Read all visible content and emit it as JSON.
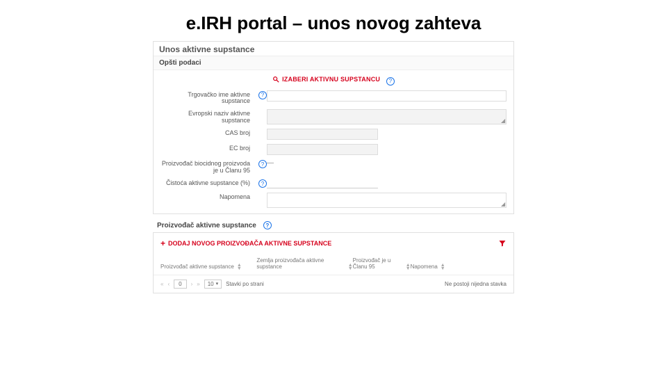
{
  "title": "e.IRH portal – unos novog zahteva",
  "panel1": {
    "title": "Unos aktivne supstance",
    "section": "Opšti podaci",
    "select_btn": "IZABERI AKTIVNU SUPSTANCU",
    "labels": {
      "trgovacko": "Trgovačko ime aktivne supstance",
      "evropski": "Evropski naziv aktivne supstance",
      "cas": "CAS broj",
      "ec": "EC broj",
      "clan95": "Proizvođač biocidnog proizvoda je u Članu 95",
      "cistoca": "Čistoća aktivne supstance (%)",
      "napomena": "Napomena"
    }
  },
  "panel2": {
    "section": "Proizvođač aktivne supstance",
    "add_btn": "DODAJ NOVOG PROIZVOĐAČA AKTIVNE SUPSTANCE",
    "columns": {
      "c1": "Proizvođač aktivne supstance",
      "c2": "Zemlja proizvođača aktivne supstance",
      "c3": "Proizvođač je u Članu 95",
      "c4": "Napomena"
    },
    "pager": {
      "page": "0",
      "size": "10",
      "size_label": "Stavki po strani",
      "empty": "Ne postoji nijedna stavka"
    }
  }
}
